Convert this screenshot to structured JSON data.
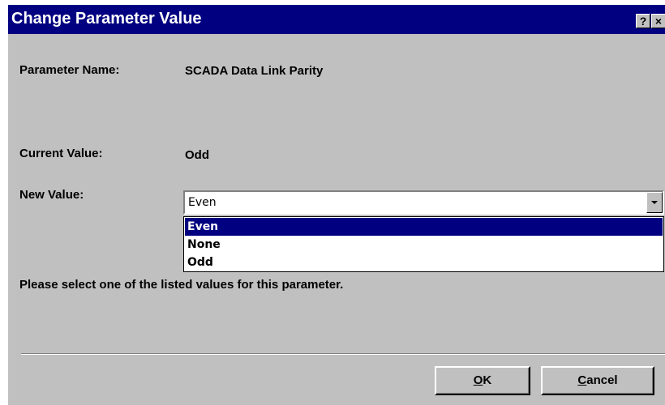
{
  "window": {
    "title": "Change Parameter Value",
    "help_label": "?",
    "close_label": "×"
  },
  "fields": {
    "parameter_name_label": "Parameter Name:",
    "parameter_name_value": "SCADA Data Link Parity",
    "current_value_label": "Current Value:",
    "current_value": "Odd",
    "new_value_label": "New Value:"
  },
  "new_value_select": {
    "selected": "Even",
    "options": [
      {
        "label": "Even",
        "highlighted": true
      },
      {
        "label": "None",
        "highlighted": false
      },
      {
        "label": "Odd",
        "highlighted": false
      }
    ]
  },
  "hint": "Please select one of the listed values for this parameter.",
  "buttons": {
    "ok_mnemonic": "O",
    "ok_rest": "K",
    "cancel_mnemonic": "C",
    "cancel_rest": "ancel"
  },
  "colors": {
    "titlebar": "#000080",
    "dialog_bg": "#c0c0c0",
    "selection_bg": "#000080"
  },
  "icons": {
    "dropdown_arrow": "chevron-down-icon",
    "help": "question-icon",
    "close": "close-icon"
  }
}
